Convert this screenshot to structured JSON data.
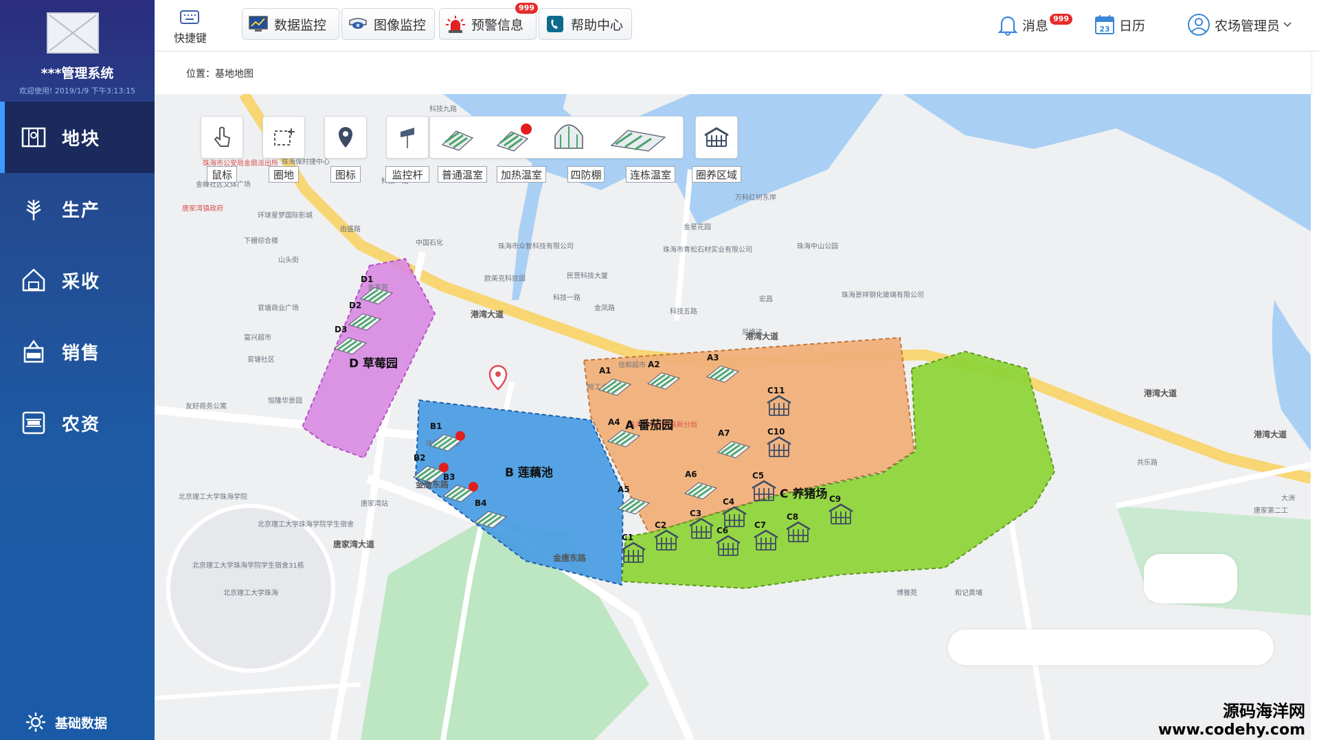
{
  "sidebar": {
    "system_title": "***管理系统",
    "welcome": "欢迎使用! 2019/1/9 下午3:13:15",
    "nav_items": [
      {
        "label": "地块",
        "icon": "map-icon",
        "active": true
      },
      {
        "label": "生产",
        "icon": "wheat-icon"
      },
      {
        "label": "采收",
        "icon": "harvest-house-icon"
      },
      {
        "label": "销售",
        "icon": "sale-bag-icon"
      },
      {
        "label": "农资",
        "icon": "supplies-box-icon"
      }
    ],
    "base_data_label": "基础数据"
  },
  "topbar": {
    "quick_key_label": "快捷键",
    "buttons": [
      {
        "label": "数据监控",
        "icon": "data-monitor-icon"
      },
      {
        "label": "图像监控",
        "icon": "camera-icon"
      },
      {
        "label": "预警信息",
        "icon": "alarm-icon",
        "badge": "999"
      },
      {
        "label": "帮助中心",
        "icon": "help-phone-icon"
      }
    ],
    "messages_label": "消息",
    "messages_badge": "999",
    "calendar_label": "日历",
    "calendar_day": "23",
    "user_label": "农场管理员"
  },
  "breadcrumb": "位置：基地地图",
  "map_toolbar": {
    "tools": [
      {
        "label": "鼠标",
        "icon": "pointer-hand-icon"
      },
      {
        "label": "圈地",
        "icon": "draw-area-icon"
      },
      {
        "label": "图标",
        "icon": "map-pin-icon"
      },
      {
        "label": "监控杆",
        "icon": "monitor-pole-icon"
      },
      {
        "label": "普通温室",
        "icon": "greenhouse-icon"
      },
      {
        "label": "加热温室",
        "icon": "heated-greenhouse-icon"
      },
      {
        "label": "四防棚",
        "icon": "four-proof-shed-icon"
      },
      {
        "label": "连栋温室",
        "icon": "multi-span-greenhouse-icon"
      },
      {
        "label": "圈养区域",
        "icon": "pen-area-icon"
      }
    ]
  },
  "zones": [
    {
      "name": "D 草莓园",
      "color": "#d98be3",
      "units": [
        "D1",
        "D2",
        "D3"
      ]
    },
    {
      "name": "B 莲藕池",
      "color": "#4c9ee3",
      "units": [
        "B1",
        "B2",
        "B3",
        "B4"
      ]
    },
    {
      "name": "A 番茄园",
      "color": "#f0b07a",
      "units": [
        "A1",
        "A2",
        "A3",
        "A4",
        "A5",
        "A6",
        "A7"
      ]
    },
    {
      "name": "C 养猪场",
      "color": "#8fd43a",
      "units": [
        "C1",
        "C2",
        "C3",
        "C4",
        "C5",
        "C6",
        "C7",
        "C8",
        "C9",
        "C10",
        "C11"
      ]
    }
  ],
  "map_labels": {
    "roads": [
      "港湾大道",
      "港湾大道",
      "港湾大道",
      "港湾大道",
      "科技一路",
      "金凤路",
      "科技五路",
      "金唐东路",
      "金唐东路",
      "唐家湾大道",
      "科技一路",
      "哈工大路",
      "由盛路"
    ],
    "pois": [
      "珠海市公安局金鼎派出所",
      "金峰社区文体广场",
      "唐家湾镇政府",
      "环球星梦国际影城",
      "下栅综合楼",
      "中国石化",
      "珠海保时捷中心",
      "珠海市众智科技有限公司",
      "欧美克科技园",
      "民营科技大厦",
      "珠海市青松石材实业有限公司",
      "金星花园",
      "万科红树东岸",
      "珠海中山公园",
      "珠海景祥钢化玻璃有限公司",
      "宏昌",
      "尼维达",
      "信和超市",
      "珠海市公安局高新分局",
      "珠海信息港",
      "富兴超市",
      "官塘社区",
      "官塘商业广场",
      "金发苑",
      "恒隆华景园",
      "友好商务公寓",
      "北京理工大学珠海学院",
      "北京理工大学珠海学院学生宿舍",
      "北京理工大学珠海学院学生宿舍31栋",
      "北京理工大学珠海",
      "唐家湾站",
      "山头街",
      "唐家第二工",
      "大洲",
      "博雅苑",
      "和记黄埔",
      "共乐路",
      "科技九路"
    ]
  },
  "watermark": {
    "line1": "源码海洋网",
    "line2": "www.codehy.com"
  }
}
